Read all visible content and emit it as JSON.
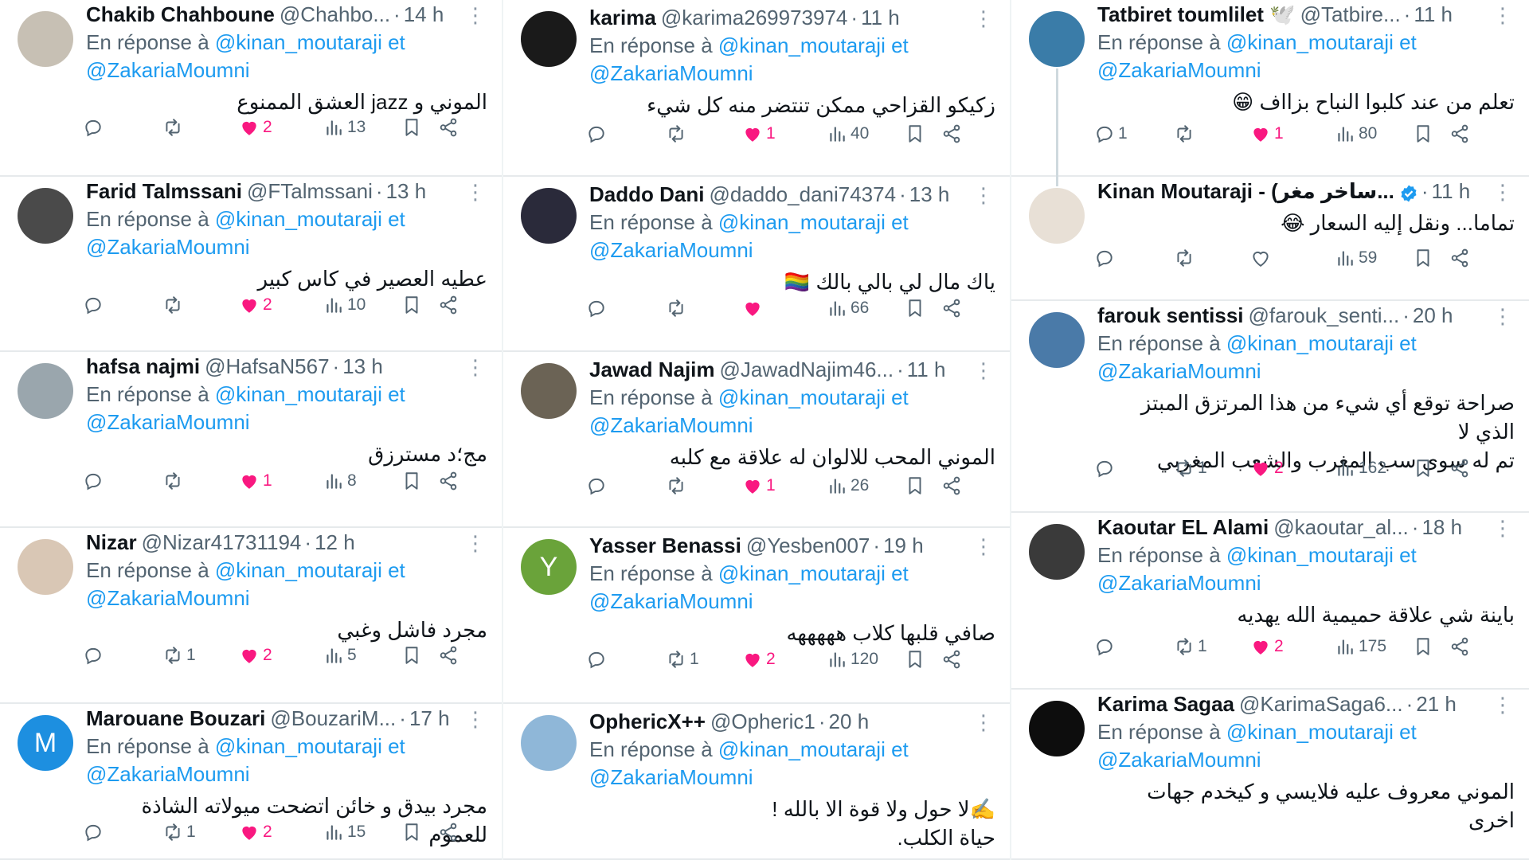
{
  "reply_prefix": "En réponse à",
  "columns": [
    [
      {
        "name": "Chakib Chahboune",
        "handle": "@Chahbo...",
        "time": "14 h",
        "mention1": "@kinan_moutaraji et",
        "mention2": "@ZakariaMoumni",
        "text": "الموني و jazz العشق الممنوع",
        "replies": "",
        "retweets": "",
        "likes": "2",
        "liked": true,
        "views": "13",
        "avatar_color": "#c7c0b4"
      },
      {
        "name": "Farid Talmssani",
        "handle": "@FTalmssani",
        "time": "13 h",
        "mention1": "@kinan_moutaraji et",
        "mention2": "@ZakariaMoumni",
        "text": "عطيه العصير في كاس كبير",
        "replies": "",
        "retweets": "",
        "likes": "2",
        "liked": true,
        "views": "10",
        "avatar_color": "#4a4a4a"
      },
      {
        "name": "hafsa najmi",
        "handle": "@HafsaN567",
        "time": "13 h",
        "mention1": "@kinan_moutaraji et",
        "mention2": "@ZakariaMoumni",
        "text": "مج؛د مسترزق",
        "replies": "",
        "retweets": "",
        "likes": "1",
        "liked": true,
        "views": "8",
        "avatar_color": "#9aa6ad"
      },
      {
        "name": "Nizar",
        "handle": "@Nizar41731194",
        "time": "12 h",
        "mention1": "@kinan_moutaraji et",
        "mention2": "@ZakariaMoumni",
        "text": "مجرد فاشل وغبي",
        "replies": "",
        "retweets": "1",
        "likes": "2",
        "liked": true,
        "views": "5",
        "avatar_color": "#d9c7b5"
      },
      {
        "name": "Marouane Bouzari",
        "handle": "@BouzariM...",
        "time": "17 h",
        "mention1": "@kinan_moutaraji et",
        "mention2": "@ZakariaMoumni",
        "text": "مجرد بيدق و خائن اتضحت ميولاته الشاذة للعموم",
        "replies": "",
        "retweets": "1",
        "likes": "2",
        "liked": true,
        "views": "15",
        "avatar_color": "#1d8fe0",
        "avatar_letter": "M"
      }
    ],
    [
      {
        "name": "karima",
        "handle": "@karima269973974",
        "time": "11 h",
        "mention1": "@kinan_moutaraji et",
        "mention2": "@ZakariaMoumni",
        "text": "زكيكو القزاحي ممكن تنتضر منه كل شيء",
        "replies": "",
        "retweets": "",
        "likes": "1",
        "liked": true,
        "views": "40",
        "avatar_color": "#1a1a1a"
      },
      {
        "name": "Daddo Dani",
        "handle": "@daddo_dani74374",
        "time": "13 h",
        "mention1": "@kinan_moutaraji et",
        "mention2": "@ZakariaMoumni",
        "text": "ياك مال لي بالي بالك 🏳️‍🌈",
        "replies": "",
        "retweets": "",
        "likes": "",
        "liked": true,
        "views": "66",
        "avatar_color": "#2a2a3a"
      },
      {
        "name": "Jawad Najim",
        "handle": "@JawadNajim46...",
        "time": "11 h",
        "mention1": "@kinan_moutaraji et",
        "mention2": "@ZakariaMoumni",
        "text": "الموني المحب للالوان له علاقة مع كلبه",
        "replies": "",
        "retweets": "",
        "likes": "1",
        "liked": true,
        "views": "26",
        "avatar_color": "#6b6355"
      },
      {
        "name": "Yasser Benassi",
        "handle": "@Yesben007",
        "time": "19 h",
        "mention1": "@kinan_moutaraji et",
        "mention2": "@ZakariaMoumni",
        "text": "صافي قلبها كلاب هههههه",
        "replies": "",
        "retweets": "1",
        "likes": "2",
        "liked": true,
        "views": "120",
        "avatar_color": "#6aa33a",
        "avatar_letter": "Y"
      },
      {
        "name": "OphericX++",
        "handle": "@Opheric1",
        "time": "20 h",
        "mention1": "@kinan_moutaraji et",
        "mention2": "@ZakariaMoumni",
        "text": "✍️لا حول ولا قوة الا بالله !",
        "text2": "حياة الكلب.",
        "replies": "",
        "retweets": "",
        "likes": "",
        "liked": false,
        "views": "",
        "avatar_color": "#8fb7d8"
      }
    ],
    [
      {
        "name": "Tatbiret toumlilet 🕊️",
        "handle": "@Tatbire...",
        "time": "11 h",
        "mention1": "@kinan_moutaraji et",
        "mention2": "@ZakariaMoumni",
        "text": "تعلم من عند كلبوا النباح بزااف 😁",
        "replies": "1",
        "retweets": "",
        "likes": "1",
        "liked": true,
        "views": "80",
        "avatar_color": "#3a7ca8"
      },
      {
        "name": "Kinan Moutaraji - (ساخر مغر...",
        "handle": "",
        "time": "11 h",
        "verified": true,
        "mention1": "",
        "mention2": "",
        "text": "تماما... ونقل إليه السعار 😂",
        "replies": "",
        "retweets": "",
        "likes": "",
        "liked": false,
        "views": "59",
        "avatar_color": "#e8e0d6"
      },
      {
        "name": "farouk sentissi",
        "handle": "@farouk_senti...",
        "time": "20 h",
        "mention1": "@kinan_moutaraji et",
        "mention2": "@ZakariaMoumni",
        "text": "صراحة توقع أي شيء من هذا المرتزق المبتز الذي لا",
        "text2": "تم له سوى سب المغرب والشعب المغربي",
        "replies": "",
        "retweets": "1",
        "likes": "2",
        "liked": true,
        "views": "162",
        "avatar_color": "#4a7aa8"
      },
      {
        "name": "Kaoutar EL Alami",
        "handle": "@kaoutar_al...",
        "time": "18 h",
        "mention1": "@kinan_moutaraji et",
        "mention2": "@ZakariaMoumni",
        "text": "باينة شي علاقة حميمية الله يهديه",
        "replies": "",
        "retweets": "1",
        "likes": "2",
        "liked": true,
        "views": "175",
        "avatar_color": "#3a3a3a"
      },
      {
        "name": "Karima Sagaa",
        "handle": "@KarimaSaga6...",
        "time": "21 h",
        "mention1": "@kinan_moutaraji et",
        "mention2": "@ZakariaMoumni",
        "text": "الموني معروف عليه فلايسي و كيخدم جهات",
        "text2": "اخرى",
        "replies": "",
        "retweets": "",
        "likes": "",
        "liked": false,
        "views": "",
        "avatar_color": "#0d0d0d"
      }
    ]
  ]
}
